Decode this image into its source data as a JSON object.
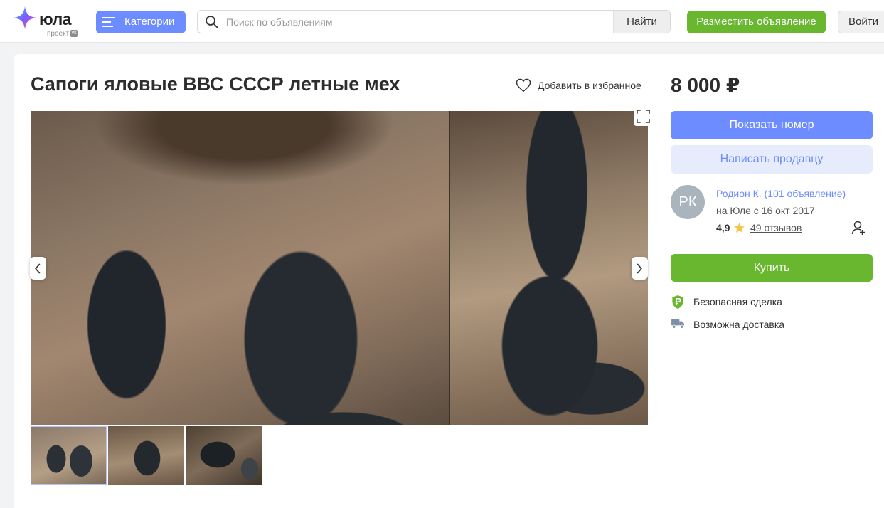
{
  "header": {
    "logo_text": "юла",
    "logo_sub": "проект",
    "logo_badge": "vk",
    "categories_label": "Категории",
    "search_placeholder": "Поиск по объявлениям",
    "search_value": "",
    "find_label": "Найти",
    "post_ad_label": "Разместить объявление",
    "login_label": "Войти"
  },
  "listing": {
    "title": "Сапоги яловые ВВС СССР летные мех",
    "favorite_label": "Добавить в избранное",
    "price": "8 000 ₽",
    "photo_count": 3
  },
  "actions": {
    "show_phone": "Показать номер",
    "write_seller": "Написать продавцу",
    "buy": "Купить"
  },
  "seller": {
    "initials": "РК",
    "name": "Родион К. (101 объявление)",
    "since": "на Юле с 16 окт 2017",
    "rating": "4,9",
    "reviews": "49 отзывов"
  },
  "features": [
    {
      "label": "Безопасная сделка",
      "icon": "shield-ruble-icon"
    },
    {
      "label": "Возможна доставка",
      "icon": "delivery-truck-icon"
    }
  ],
  "colors": {
    "accent_blue": "#6c8cff",
    "accent_green": "#69b62f",
    "light_blue": "#e7ecfd"
  }
}
